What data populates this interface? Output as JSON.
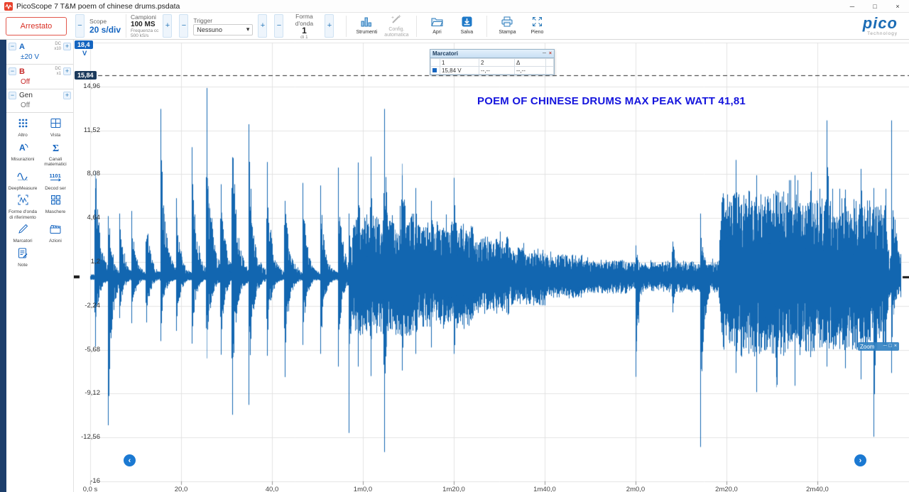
{
  "title_bar": {
    "title": "PicoScope 7 T&M poem of chinese drums.psdata"
  },
  "glyphs": {
    "minus": "−",
    "plus": "+",
    "win_min": "─",
    "win_max": "□",
    "win_close": "×",
    "nav_left": "‹",
    "nav_right": "›",
    "caret": "▾",
    "zoom_box": "□"
  },
  "toolbar": {
    "stop_button": "Arrestato",
    "scope": {
      "label": "Scope",
      "value": "20 s/div"
    },
    "samples": {
      "label": "Campioni",
      "value": "100 MS",
      "sub1": "Frequenza cc",
      "sub2": "500 kS/s"
    },
    "trigger": {
      "label": "Trigger",
      "value": "Nessuno"
    },
    "waveform": {
      "label": "Forma d'onda",
      "value": "1",
      "sub": "di 1"
    },
    "buttons": {
      "tools": "Strumenti",
      "autoconfig": "Config. automatica",
      "open": "Apri",
      "save": "Salva",
      "print": "Stampa",
      "full": "Pieno"
    },
    "logo": {
      "brand": "pico",
      "tagline": "Technology"
    }
  },
  "sidebar": {
    "channels": [
      {
        "name": "A",
        "coupling": "DC",
        "probe": "x10",
        "range": "±20 V"
      },
      {
        "name": "B",
        "coupling": "DC",
        "probe": "x1",
        "range": "Off"
      },
      {
        "name": "Gen",
        "range": "Off"
      }
    ],
    "tools": [
      {
        "label": "Altro"
      },
      {
        "label": "Vista"
      },
      {
        "label": "Misurazioni"
      },
      {
        "label": "Canali matematici"
      },
      {
        "label": "DeepMeasure"
      },
      {
        "label": "Decod ser"
      },
      {
        "label": "Forme d'onda di riferimento"
      },
      {
        "label": "Maschere"
      },
      {
        "label": "Marcatori"
      },
      {
        "label": "Azioni"
      },
      {
        "label": "Note"
      }
    ]
  },
  "markers_window": {
    "title": "Marcatori",
    "columns": [
      "1",
      "2",
      "Δ"
    ],
    "row": {
      "value1": "15,84 V",
      "value2": "--,--",
      "delta": "--,--"
    }
  },
  "zoom_overlay": {
    "label": "Zoom"
  },
  "annotation": "POEM OF CHINESE DRUMS MAX PEAK WATT 41,81",
  "chart_data": {
    "type": "line",
    "channel": "A",
    "title": "poem of chinese drums",
    "y_unit": "V",
    "x_unit": "s",
    "timebase": "20 s/div",
    "ylim": [
      -16,
      18.4
    ],
    "y_div": 3.44,
    "marker_v": 15.84,
    "y_top_tag": {
      "label": "18,4"
    },
    "marker_tag": {
      "label": "15,84"
    },
    "color": "#1266b0",
    "baseline": 0.25,
    "t_end": 178.3,
    "y_ticks": [
      {
        "label": "14,96",
        "v": 14.96
      },
      {
        "label": "11,52",
        "v": 11.52
      },
      {
        "label": "8,08",
        "v": 8.08
      },
      {
        "label": "4,64",
        "v": 4.64
      },
      {
        "label": "1,2",
        "v": 1.2
      },
      {
        "label": "-2,24",
        "v": -2.24
      },
      {
        "label": "-5,68",
        "v": -5.68
      },
      {
        "label": "-9,12",
        "v": -9.12
      },
      {
        "label": "-12,56",
        "v": -12.56
      },
      {
        "label": "-16",
        "v": -16
      }
    ],
    "x_ticks": [
      {
        "label": "0,0 s",
        "t": 0
      },
      {
        "label": "20,0",
        "t": 20
      },
      {
        "label": "40,0",
        "t": 40
      },
      {
        "label": "1m0,0",
        "t": 60
      },
      {
        "label": "1m20,0",
        "t": 80
      },
      {
        "label": "1m40,0",
        "t": 100
      },
      {
        "label": "2m0,0",
        "t": 120
      },
      {
        "label": "2m20,0",
        "t": 140
      },
      {
        "label": "2m40,0",
        "t": 160
      }
    ],
    "hits": [
      [
        1.0,
        10.6,
        5.5
      ],
      [
        3.9,
        4.8,
        11.6
      ],
      [
        6.4,
        5.0,
        3.2
      ],
      [
        9.0,
        5.2,
        3.6
      ],
      [
        12.2,
        5.6,
        4.0
      ],
      [
        15.4,
        13.2,
        5.0
      ],
      [
        18.9,
        6.2,
        4.2
      ],
      [
        22.3,
        10.2,
        5.2
      ],
      [
        25.5,
        15.7,
        8.0
      ],
      [
        28.6,
        9.2,
        6.2
      ],
      [
        31.1,
        14.0,
        12.7
      ],
      [
        34.8,
        12.0,
        10.0
      ],
      [
        38.8,
        9.2,
        6.5
      ],
      [
        42.7,
        8.2,
        8.0
      ],
      [
        46.7,
        7.4,
        5.3
      ],
      [
        50.6,
        7.2,
        6.0
      ],
      [
        54.5,
        8.6,
        7.0
      ],
      [
        56.8,
        5.0,
        12.2
      ],
      [
        58.9,
        9.0,
        7.0
      ],
      [
        61.6,
        11.0,
        9.0
      ],
      [
        64.6,
        13.2,
        13.7
      ],
      [
        68.5,
        12.2,
        8.0
      ],
      [
        71.5,
        7.0,
        6.0
      ],
      [
        75.0,
        6.0,
        5.5
      ],
      [
        80.0,
        7.8,
        6.0
      ],
      [
        120.0,
        2.5,
        7.8
      ],
      [
        128.0,
        4.0,
        3.0
      ],
      [
        134.2,
        5.0,
        13.3
      ],
      [
        142.0,
        9.2,
        7.5
      ],
      [
        146.5,
        8.0,
        9.0
      ],
      [
        150.8,
        9.6,
        12.6
      ],
      [
        155.0,
        8.0,
        8.5
      ],
      [
        158.5,
        9.0,
        7.0
      ],
      [
        162.0,
        12.3,
        7.0
      ],
      [
        166.0,
        8.0,
        9.0
      ],
      [
        169.5,
        8.5,
        8.0
      ],
      [
        172.3,
        7.0,
        12.5
      ],
      [
        176.2,
        12.3,
        7.5
      ]
    ],
    "dense": [
      [
        58,
        72,
        5.0
      ],
      [
        72,
        84,
        4.4
      ],
      [
        84,
        92,
        3.2
      ],
      [
        92,
        100,
        2.4
      ],
      [
        100,
        108,
        1.8
      ],
      [
        108,
        118,
        1.4
      ],
      [
        118,
        126,
        1.2
      ],
      [
        126,
        139,
        1.3
      ],
      [
        139,
        160,
        6.8
      ],
      [
        160,
        175,
        6.2
      ],
      [
        174.5,
        178.3,
        1.8
      ]
    ]
  }
}
